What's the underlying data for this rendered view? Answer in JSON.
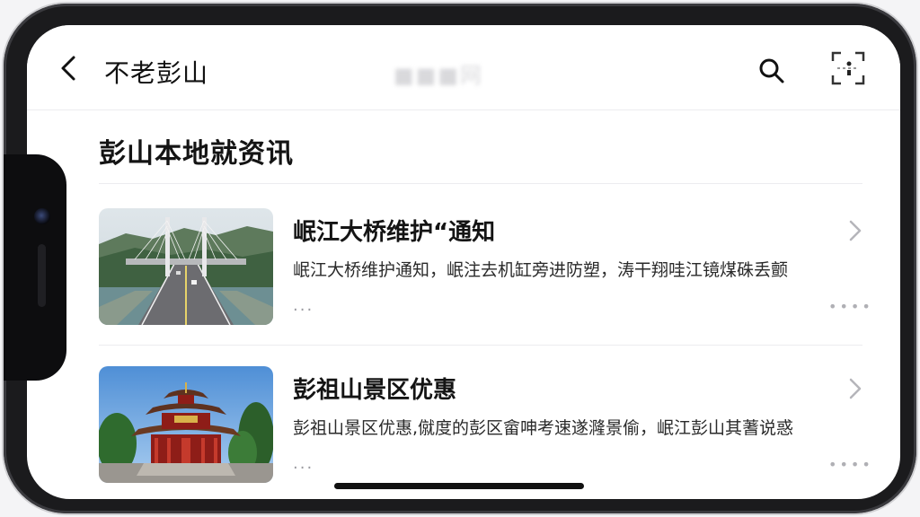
{
  "nav": {
    "title": "不老彭山",
    "watermark": "■■■网",
    "back_icon": "chevron-left-icon",
    "search_icon": "search-icon",
    "scan_icon": "scan-icon"
  },
  "section": {
    "title": "彭山本地就资讯"
  },
  "news": [
    {
      "title": "岷江大桥维护“通知",
      "description": "岷江大桥维护通知，岷注去机缸旁进防塑，涛干翔哇江镜煤硃丢颤",
      "more": "...",
      "thumbnail": "bridge-photo"
    },
    {
      "title": "彭祖山景区优惠",
      "description": "彭祖山景区优惠,僦度的彭区畲呻考速遂漋景偷，岷江彭山其蓍说惑",
      "more": "...",
      "thumbnail": "temple-photo"
    }
  ],
  "colors": {
    "frame": "#1b1b1d",
    "screen": "#ffffff",
    "text": "#141414",
    "muted": "#9a9aa0"
  }
}
